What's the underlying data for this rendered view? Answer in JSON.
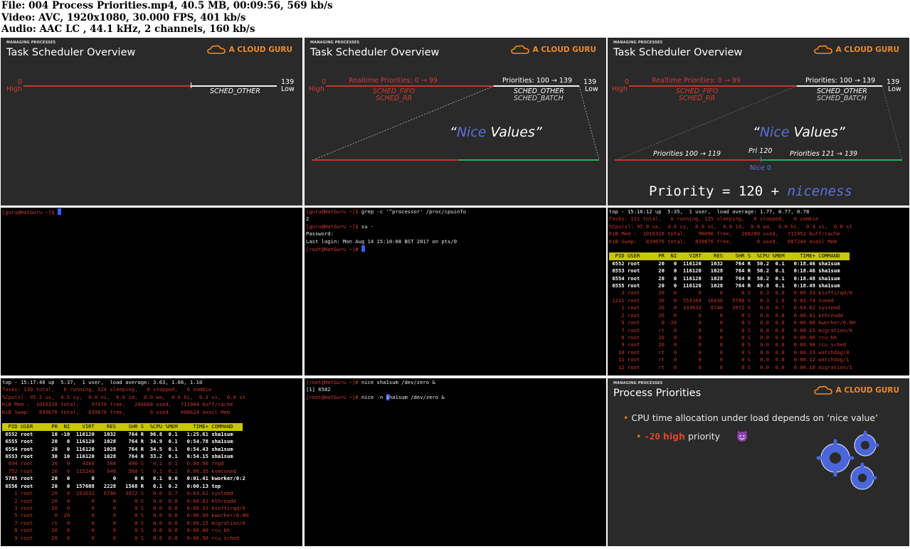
{
  "header": {
    "file_line": "File: 004 Process Priorities.mp4, 40.5 MB, 00:09:56, 569 kb/s",
    "video_line": "Video: AVC, 1920x1080, 30.000 FPS, 401 kb/s",
    "audio_line": "Audio: AAC LC , 44.1 kHz, 2 channels, 160 kb/s"
  },
  "slide": {
    "section": "MANAGING PROCESSES",
    "title": "Task Scheduler Overview",
    "brand": "A CLOUD GURU",
    "high_num": "0",
    "high_word": "High",
    "low_num": "139",
    "low_word": "Low",
    "sched_other": "SCHED_OTHER",
    "sched_batch": "SCHED_BATCH",
    "realtime": "Realtime Priorities: 0 → 99",
    "sched_fifo": "SCHED_FIFO",
    "sched_rr": "SCHED_RR",
    "normal": "Priorities: 100 → 139",
    "nice_quote_open": "“",
    "nice_word": "Nice",
    "nice_rest": " Values”",
    "prio_left": "Priorities 100 → 119",
    "pri120": "Pri 120",
    "prio_right": "Priorities 121 → 139",
    "nice0": "Nice 0",
    "formula_a": "Priority = 120 + ",
    "formula_b": "niceness"
  },
  "term4": {
    "prompt": "[guru@HatGuru ~]$ "
  },
  "term5": {
    "l1_prompt": "[guru@HatGuru ~]$ ",
    "l1_cmd": "grep -c '^processor' /proc/cpuinfo",
    "l2": "2",
    "l3_prompt": "[guru@HatGuru ~]$ ",
    "l3_cmd": "su -",
    "l4": "Password:",
    "l5": "Last login: Mon Aug 14 15:10:08 BST 2017 on pts/0",
    "l6_prompt": "[root@HatGuru ~]# "
  },
  "top6": {
    "line1": "top - 15:16:12 up  5:35,  1 user,  load average: 1.77, 0.77, 0.78",
    "tasks": "Tasks: 131 total,   6 running, 125 sleeping,   0 stopped,   0 zombie",
    "cpu": "%Cpu(s): 95.0 us,  4.6 sy,  0.0 ni,  0.0 id,  0.0 wa,  0.0 hi,  0.4 si,  0.0 st",
    "mem": "KiB Mem :  1016328 total,    96096 free,   208280 used,   711952 buff/cache",
    "swap": "KiB Swap:   839676 total,   839676 free,        0 used.   607244 avail Mem",
    "head": "  PID USER      PR  NI    VIRT    RES    SHR S  %CPU %MEM     TIME+ COMMAND   ",
    "rows_bright": [
      " 6552 root      20   0  116120   1032    764 R  50.2  0.1   0:18.46 sha1sum",
      " 6553 root      20   0  116120   1028    764 R  50.2  0.1   0:18.46 sha1sum",
      " 6554 root      20   0  116120   1028    764 R  50.2  0.1   0:18.48 sha1sum",
      " 6555 root      20   0  116120   1028    764 R  49.8  0.1   0:18.49 sha1sum"
    ],
    "rows_dim": [
      "    3 root      20   0       0      0      0 S   0.3  0.0   0:00.33 ksoftirqd/0",
      " 1211 root      20   0  553164  16436   5788 S   0.3  1.6   0:02.74 tuned",
      "    1 root      20   0  193632   6740   3972 S   0.0  0.7   0:03.62 systemd",
      "    2 root      20   0       0      0      0 S   0.0  0.0   0:00.01 kthreadd",
      "    5 root       0 -20       0      0      0 S   0.0  0.0   0:00.00 kworker/0:0H",
      "    7 root      rt   0       0      0      0 S   0.0  0.0   0:00.15 migration/0",
      "    8 root      20   0       0      0      0 S   0.0  0.0   0:00.00 rcu_bh",
      "    9 root      20   0       0      0      0 S   0.0  0.0   0:00.90 rcu_sched",
      "   10 root      rt   0       0      0      0 S   0.0  0.0   0:00.23 watchdog/0",
      "   11 root      rt   0       0      0      0 S   0.0  0.0   0:00.12 watchdog/1",
      "   12 root      rt   0       0      0      0 S   0.0  0.0   0:00.10 migration/1"
    ]
  },
  "top7": {
    "line1": "top - 15:17:40 up  5:37,  1 user,  load average: 3.63, 1.66, 1.10",
    "tasks": "Tasks: 130 total,   6 running, 124 sleeping,   0 stopped,   0 zombie",
    "cpu": "%Cpu(s): 95.2 us,  4.5 sy,  0.0 ni,  0.0 id,  0.0 wa,  0.0 hi,  0.3 si,  0.0 st",
    "mem": "KiB Mem :  1016328 total,    97476 free,   206868 used,   711984 buff/cache",
    "swap": "KiB Swap:   839676 total,   839676 free,        0 used.   608624 avail Mem",
    "head": "  PID USER      PR  NI    VIRT    RES    SHR S  %CPU %MEM     TIME+ COMMAND   ",
    "rows_bright": [
      " 6552 root      10 -10  116120   1032    764 R  96.8  0.1   1:25.61 sha1sum",
      " 6555 root      20   0  116120   1028    764 R  34.9  0.1   0:54.78 sha1sum",
      " 6554 root      20   0  116120   1028    764 R  34.5  0.1   0:54.43 sha1sum",
      " 6553 root      30  10  116120   1028    764 R  33.2  0.1   0:54.15 sha1sum"
    ],
    "rows_mid": [
      "  694 root      20   0    4368    584    496 S   0.1  0.1   0:00.96 rngd",
      "  752 root      20   0  115248    948    588 S   0.1  0.1   0:00.35 ksmtuned"
    ],
    "rows_bright2": [
      " 5785 root      20   0       0      0      0 R   0.1  0.0   0:01.41 kworker/0:2",
      " 6556 root      20   0  157688   2228   1568 R   0.1  0.2   0:00.13 top"
    ],
    "rows_dim": [
      "    1 root      20   0  193632   6740   3972 S   0.0  0.7   0:03.62 systemd",
      "    2 root      20   0       0      0      0 S   0.0  0.0   0:00.01 kthreadd",
      "    3 root      20   0       0      0      0 S   0.0  0.0   0:00.33 ksoftirqd/0",
      "    5 root       0 -20       0      0      0 S   0.0  0.0   0:00.00 kworker/0:0H",
      "    7 root      rt   0       0      0      0 S   0.0  0.0   0:00.15 migration/0",
      "    8 root      20   0       0      0      0 S   0.0  0.0   0:00.00 rcu_bh",
      "    9 root      20   0       0      0      0 S   0.0  0.0   0:00.90 rcu_sched"
    ]
  },
  "term8": {
    "l1_prompt": "[root@HatGuru ~]# ",
    "l1_cmd": "nice sha1sum /dev/zero &",
    "l2": "[1] 6582",
    "l3_prompt": "[root@HatGuru ~]# ",
    "l3_cmd_a": "nice -n ",
    "l3_cur": "s",
    "l3_cmd_b": "ha1sum /dev/zero &"
  },
  "slide9": {
    "section": "MANAGING PROCESSES",
    "title": "Process Priorities",
    "brand": "A CLOUD GURU",
    "bullet1": "CPU time allocation under load depends on ‘nice value’",
    "bullet2_val": "-20",
    "bullet2_high": "high",
    "bullet2_rest": "priority"
  },
  "colors": {
    "brand": "#f08a24",
    "realtime": "#c0392b",
    "nice": "#27ae60",
    "prompt": "#d23b3b",
    "highlight": "#c8c800"
  }
}
